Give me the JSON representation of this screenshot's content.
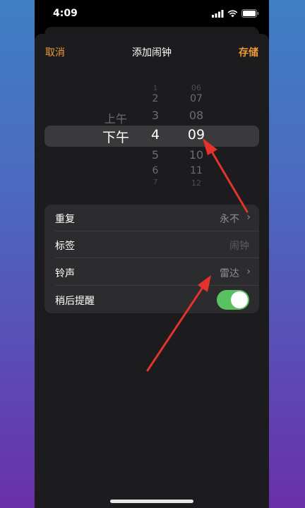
{
  "status_bar": {
    "time": "4:09",
    "icons": [
      "cellular-signal-icon",
      "wifi-icon",
      "battery-icon"
    ]
  },
  "nav": {
    "cancel_label": "取消",
    "title": "添加闹钟",
    "save_label": "存储"
  },
  "picker": {
    "period": {
      "items": [
        "上午",
        "下午"
      ],
      "selected": "下午"
    },
    "hour": {
      "items": [
        "1",
        "2",
        "3",
        "4",
        "5",
        "6",
        "7"
      ],
      "selected": "4"
    },
    "minute": {
      "items": [
        "06",
        "07",
        "08",
        "09",
        "10",
        "11",
        "12"
      ],
      "selected": "09"
    }
  },
  "settings": {
    "repeat": {
      "label": "重复",
      "value": "永不"
    },
    "tag": {
      "label": "标签",
      "placeholder": "闹钟"
    },
    "sound": {
      "label": "铃声",
      "value": "雷达"
    },
    "snooze": {
      "label": "稍后提醒",
      "on": true
    }
  },
  "colors": {
    "accent": "#f09a37",
    "toggle_on": "#5ac161",
    "sheet_bg": "#1c1c1e",
    "group_bg": "#2c2c2e",
    "annotation_arrow": "#e5322d"
  }
}
